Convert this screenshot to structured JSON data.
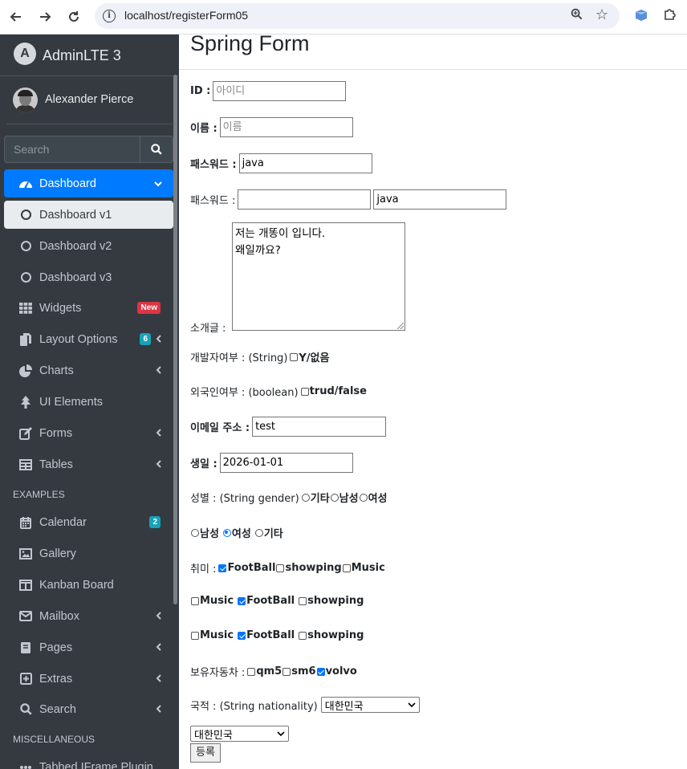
{
  "browser": {
    "url": "localhost/registerForm05"
  },
  "sidebar": {
    "brand": "AdminLTE 3",
    "brand_logo_letter": "A",
    "user_name": "Alexander Pierce",
    "search_placeholder": "Search",
    "items": [
      {
        "label": "Dashboard",
        "icon": "dashboard-icon"
      },
      {
        "label": "Dashboard v1",
        "icon": "circle-icon"
      },
      {
        "label": "Dashboard v2",
        "icon": "circle-icon"
      },
      {
        "label": "Dashboard v3",
        "icon": "circle-icon"
      },
      {
        "label": "Widgets",
        "icon": "grid-icon",
        "badge": "New"
      },
      {
        "label": "Layout Options",
        "icon": "copy-icon",
        "badge": "6"
      },
      {
        "label": "Charts",
        "icon": "pie-chart-icon"
      },
      {
        "label": "UI Elements",
        "icon": "tree-icon"
      },
      {
        "label": "Forms",
        "icon": "edit-icon"
      },
      {
        "label": "Tables",
        "icon": "table-icon"
      },
      {
        "label": "Calendar",
        "icon": "calendar-icon",
        "badge": "2"
      },
      {
        "label": "Gallery",
        "icon": "image-icon"
      },
      {
        "label": "Kanban Board",
        "icon": "columns-icon"
      },
      {
        "label": "Mailbox",
        "icon": "envelope-icon"
      },
      {
        "label": "Pages",
        "icon": "book-icon"
      },
      {
        "label": "Extras",
        "icon": "plus-square-icon"
      },
      {
        "label": "Search",
        "icon": "search-icon"
      },
      {
        "label": "Tabbed IFrame Plugin",
        "icon": "ellipsis-icon"
      }
    ],
    "sections": {
      "examples": "EXAMPLES",
      "misc": "MISCELLANEOUS"
    }
  },
  "form": {
    "title": "Spring Form",
    "id_label": "ID :",
    "id_placeholder": "아이디",
    "name_label": "이름 :",
    "name_placeholder": "이름",
    "password_label": "패스워드 :",
    "password_value": "java",
    "password2_label": "패스워드 :",
    "password2_value_a": "",
    "password2_value_b": "java",
    "intro_label": "소개글 :",
    "intro_line1": "저는 개똥이 입니다.",
    "intro_line2": "왜일까요?",
    "developer_label": "개발자여부 : (String)",
    "developer_option": "Y/없음",
    "foreigner_label": "외국인여부 : (boolean)",
    "foreigner_option": "trud/false",
    "email_label": "이메일 주소 :",
    "email_value": "test",
    "birth_label": "생일 :",
    "birth_value": "2026-01-01",
    "gender_label": "성별 : (String gender)",
    "gender_options1": [
      "기타",
      "남성",
      "여성"
    ],
    "gender_options2": [
      "남성",
      "여성",
      "기타"
    ],
    "gender_selected2": "여성",
    "hobby_label": "취미 :",
    "hobby_row1": [
      "FootBall",
      "showping",
      "Music"
    ],
    "hobby_row2": [
      "Music",
      "FootBall",
      "showping"
    ],
    "hobby_row3": [
      "Music",
      "FootBall",
      "showping"
    ],
    "car_label": "보유자동차 :",
    "cars": [
      "qm5",
      "sm6",
      "volvo"
    ],
    "nationality_label": "국적 : (String nationality)",
    "nationality_value": "대한민국",
    "nationality_value2": "대한민국",
    "submit_label": "등록"
  },
  "colors": {
    "sidebar_bg": "#343a40",
    "active_blue": "#007bff",
    "badge_red": "#dc3545",
    "badge_teal": "#17a2b8"
  }
}
